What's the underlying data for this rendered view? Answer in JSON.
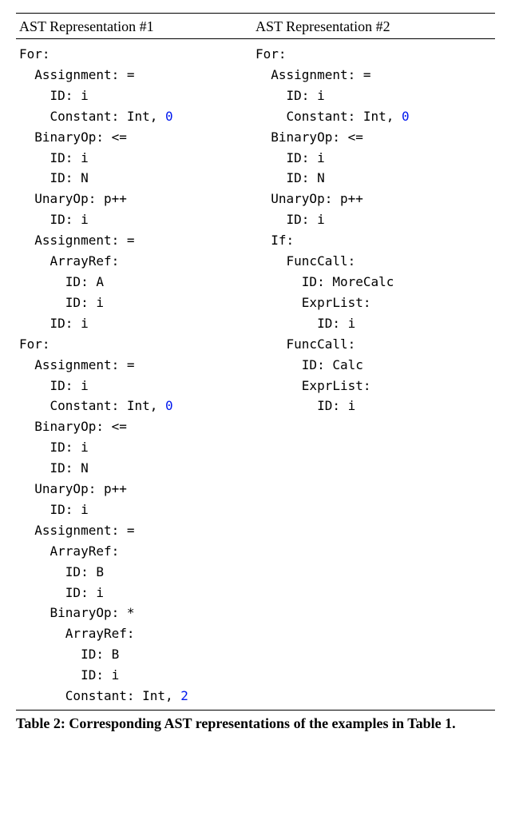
{
  "table": {
    "header_left": "AST Representation #1",
    "header_right": "AST Representation #2",
    "col_left": [
      {
        "indent": 0,
        "text": "For:"
      },
      {
        "indent": 1,
        "text": "Assignment: ="
      },
      {
        "indent": 2,
        "text": "ID: i"
      },
      {
        "indent": 2,
        "text": "Constant: Int, ",
        "num": "0"
      },
      {
        "indent": 1,
        "text": "BinaryOp: <="
      },
      {
        "indent": 2,
        "text": "ID: i"
      },
      {
        "indent": 2,
        "text": "ID: N"
      },
      {
        "indent": 1,
        "text": "UnaryOp: p++"
      },
      {
        "indent": 2,
        "text": "ID: i"
      },
      {
        "indent": 1,
        "text": "Assignment: ="
      },
      {
        "indent": 2,
        "text": "ArrayRef:"
      },
      {
        "indent": 3,
        "text": "ID: A"
      },
      {
        "indent": 3,
        "text": "ID: i"
      },
      {
        "indent": 2,
        "text": "ID: i"
      },
      {
        "indent": 0,
        "text": "For:"
      },
      {
        "indent": 1,
        "text": "Assignment: ="
      },
      {
        "indent": 2,
        "text": "ID: i"
      },
      {
        "indent": 2,
        "text": "Constant: Int, ",
        "num": "0"
      },
      {
        "indent": 1,
        "text": "BinaryOp: <="
      },
      {
        "indent": 2,
        "text": "ID: i"
      },
      {
        "indent": 2,
        "text": "ID: N"
      },
      {
        "indent": 1,
        "text": "UnaryOp: p++"
      },
      {
        "indent": 2,
        "text": "ID: i"
      },
      {
        "indent": 1,
        "text": "Assignment: ="
      },
      {
        "indent": 2,
        "text": "ArrayRef:"
      },
      {
        "indent": 3,
        "text": "ID: B"
      },
      {
        "indent": 3,
        "text": "ID: i"
      },
      {
        "indent": 2,
        "text": "BinaryOp: *"
      },
      {
        "indent": 3,
        "text": "ArrayRef:"
      },
      {
        "indent": 4,
        "text": "ID: B"
      },
      {
        "indent": 4,
        "text": "ID: i"
      },
      {
        "indent": 3,
        "text": "Constant: Int, ",
        "num": "2"
      }
    ],
    "col_right": [
      {
        "indent": 0,
        "text": "For:"
      },
      {
        "indent": 1,
        "text": "Assignment: ="
      },
      {
        "indent": 2,
        "text": "ID: i"
      },
      {
        "indent": 2,
        "text": "Constant: Int, ",
        "num": "0"
      },
      {
        "indent": 1,
        "text": "BinaryOp: <="
      },
      {
        "indent": 2,
        "text": "ID: i"
      },
      {
        "indent": 2,
        "text": "ID: N"
      },
      {
        "indent": 1,
        "text": "UnaryOp: p++"
      },
      {
        "indent": 2,
        "text": "ID: i"
      },
      {
        "indent": 1,
        "text": "If:"
      },
      {
        "indent": 2,
        "text": "FuncCall:"
      },
      {
        "indent": 3,
        "text": "ID: MoreCalc"
      },
      {
        "indent": 3,
        "text": "ExprList:"
      },
      {
        "indent": 4,
        "text": "ID: i"
      },
      {
        "indent": 2,
        "text": "FuncCall:"
      },
      {
        "indent": 3,
        "text": "ID: Calc"
      },
      {
        "indent": 3,
        "text": "ExprList:"
      },
      {
        "indent": 4,
        "text": "ID: i"
      }
    ]
  },
  "caption": "Table 2: Corresponding AST representations of the examples in Table 1."
}
